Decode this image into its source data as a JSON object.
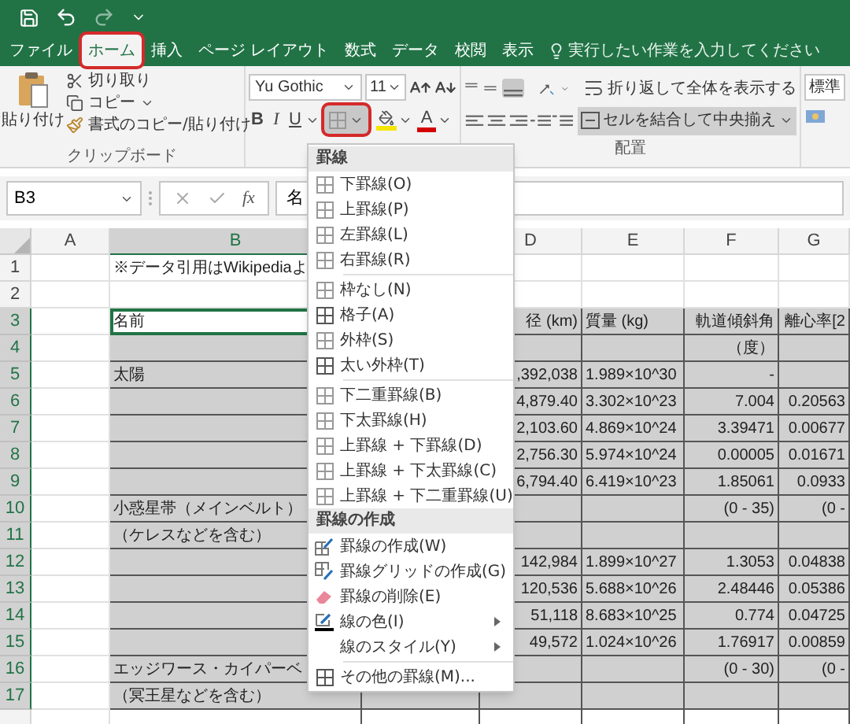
{
  "tabs": [
    {
      "label": "ファイル",
      "selected": false,
      "highlighted": false
    },
    {
      "label": "ホーム",
      "selected": true,
      "highlighted": true
    },
    {
      "label": "挿入",
      "selected": false,
      "highlighted": false
    },
    {
      "label": "ページ レイアウト",
      "selected": false,
      "highlighted": false
    },
    {
      "label": "数式",
      "selected": false,
      "highlighted": false
    },
    {
      "label": "データ",
      "selected": false,
      "highlighted": false
    },
    {
      "label": "校閲",
      "selected": false,
      "highlighted": false
    },
    {
      "label": "表示",
      "selected": false,
      "highlighted": false
    }
  ],
  "tell_me": {
    "placeholder": "実行したい作業を入力してください"
  },
  "ribbon": {
    "clipboard": {
      "paste": "貼り付け",
      "cut": "切り取り",
      "copy": "コピー",
      "format_painter": "書式のコピー/貼り付け",
      "label": "クリップボード"
    },
    "font": {
      "name": "Yu Gothic",
      "size": "11",
      "bold": "B",
      "italic": "I",
      "underline": "U",
      "font_color": "A",
      "border_button": {
        "pressed": true,
        "highlighted": true
      }
    },
    "alignment": {
      "wrap": "折り返して全体を表示する",
      "merge": "セルを結合して中央揃え",
      "label": "配置"
    },
    "number": {
      "format": "標準"
    }
  },
  "formula_bar": {
    "name_box": "B3",
    "fx": "fx",
    "content": "名"
  },
  "grid": {
    "columns": [
      {
        "label": "A",
        "kind": "text",
        "selected": false,
        "active": false
      },
      {
        "label": "B",
        "kind": "text",
        "selected": true,
        "active": true
      },
      {
        "label": "D",
        "kind": "number",
        "selected": false,
        "active": false
      },
      {
        "label": "E",
        "kind": "text",
        "selected": false,
        "active": false
      },
      {
        "label": "F",
        "kind": "number",
        "selected": false,
        "active": false
      },
      {
        "label": "G",
        "kind": "number",
        "selected": false,
        "active": false
      }
    ],
    "rows": [
      {
        "number": "1",
        "selected": false,
        "bordered": false,
        "cells": [
          null,
          "※データ引用はWikipediaよ",
          null,
          null,
          null,
          null
        ]
      },
      {
        "number": "2",
        "selected": false,
        "bordered": false,
        "cells": [
          null,
          null,
          null,
          null,
          null,
          null
        ]
      },
      {
        "number": "3",
        "selected": true,
        "active": true,
        "bordered": true,
        "cells": [
          null,
          "名前",
          "径 (km)",
          "質量 (kg)",
          "軌道傾斜角",
          "離心率[2"
        ]
      },
      {
        "number": "4",
        "selected": true,
        "bordered": true,
        "cells": [
          null,
          null,
          null,
          null,
          "（度）",
          null
        ]
      },
      {
        "number": "5",
        "selected": true,
        "bordered": true,
        "cells": [
          null,
          "太陽",
          ",392,038",
          "1.989×10^30",
          "-",
          null
        ]
      },
      {
        "number": "6",
        "selected": true,
        "bordered": true,
        "cells": [
          null,
          null,
          "4,879.40",
          "3.302×10^23",
          "7.004",
          "0.20563"
        ]
      },
      {
        "number": "7",
        "selected": true,
        "bordered": true,
        "cells": [
          null,
          null,
          "2,103.60",
          "4.869×10^24",
          "3.39471",
          "0.00677"
        ]
      },
      {
        "number": "8",
        "selected": true,
        "bordered": true,
        "cells": [
          null,
          null,
          "2,756.30",
          "5.974×10^24",
          "0.00005",
          "0.01671"
        ]
      },
      {
        "number": "9",
        "selected": true,
        "bordered": true,
        "cells": [
          null,
          null,
          "6,794.40",
          "6.419×10^23",
          "1.85061",
          "0.0933"
        ]
      },
      {
        "number": "10",
        "selected": true,
        "bordered": true,
        "cells": [
          null,
          "小惑星帯（メインベルト）",
          null,
          null,
          "(0 - 35)",
          "(0 -"
        ]
      },
      {
        "number": "11",
        "selected": true,
        "bordered": true,
        "cells": [
          null,
          "（ケレスなどを含む）",
          null,
          null,
          null,
          null
        ]
      },
      {
        "number": "12",
        "selected": true,
        "bordered": true,
        "cells": [
          null,
          null,
          "142,984",
          "1.899×10^27",
          "1.3053",
          "0.04838"
        ]
      },
      {
        "number": "13",
        "selected": true,
        "bordered": true,
        "cells": [
          null,
          null,
          "120,536",
          "5.688×10^26",
          "2.48446",
          "0.05386"
        ]
      },
      {
        "number": "14",
        "selected": true,
        "bordered": true,
        "cells": [
          null,
          null,
          "51,118",
          "8.683×10^25",
          "0.774",
          "0.04725"
        ]
      },
      {
        "number": "15",
        "selected": true,
        "bordered": true,
        "cells": [
          null,
          null,
          "49,572",
          "1.024×10^26",
          "1.76917",
          "0.00859"
        ]
      },
      {
        "number": "16",
        "selected": true,
        "bordered": true,
        "cells": [
          null,
          "エッジワース・カイパーベ",
          null,
          null,
          "(0 - 30)",
          "(0 -"
        ]
      },
      {
        "number": "17",
        "selected": true,
        "bordered": true,
        "cells": [
          null,
          "（冥王星などを含む）",
          null,
          null,
          null,
          null
        ]
      },
      {
        "selected": false,
        "bordered": true,
        "cells": [
          null,
          null,
          null,
          null,
          null,
          null
        ]
      }
    ]
  },
  "border_menu": {
    "items": [
      {
        "kind": "header",
        "label": "罫線"
      },
      {
        "kind": "border",
        "label": "下罫線(O)"
      },
      {
        "kind": "border",
        "label": "上罫線(P)"
      },
      {
        "kind": "border",
        "label": "左罫線(L)"
      },
      {
        "kind": "border",
        "label": "右罫線(R)"
      },
      {
        "kind": "separator"
      },
      {
        "kind": "border",
        "label": "枠なし(N)"
      },
      {
        "kind": "thick-border",
        "label": "格子(A)"
      },
      {
        "kind": "border",
        "label": "外枠(S)"
      },
      {
        "kind": "thick-border",
        "label": "太い外枠(T)"
      },
      {
        "kind": "separator"
      },
      {
        "kind": "border",
        "label": "下二重罫線(B)"
      },
      {
        "kind": "border",
        "label": "下太罫線(H)"
      },
      {
        "kind": "border",
        "label": "上罫線 + 下罫線(D)"
      },
      {
        "kind": "border",
        "label": "上罫線 + 下太罫線(C)"
      },
      {
        "kind": "border",
        "label": "上罫線 + 下二重罫線(U)"
      },
      {
        "kind": "header",
        "label": "罫線の作成"
      },
      {
        "kind": "draw",
        "label": "罫線の作成(W)"
      },
      {
        "kind": "grid-draw",
        "label": "罫線グリッドの作成(G)"
      },
      {
        "kind": "erase",
        "label": "罫線の削除(E)"
      },
      {
        "kind": "color",
        "label": "線の色(I)",
        "submenu": true
      },
      {
        "kind": "style",
        "label": "線のスタイル(Y)",
        "submenu": true
      },
      {
        "kind": "separator"
      },
      {
        "kind": "thick-border",
        "label": "その他の罫線(M)..."
      }
    ]
  }
}
